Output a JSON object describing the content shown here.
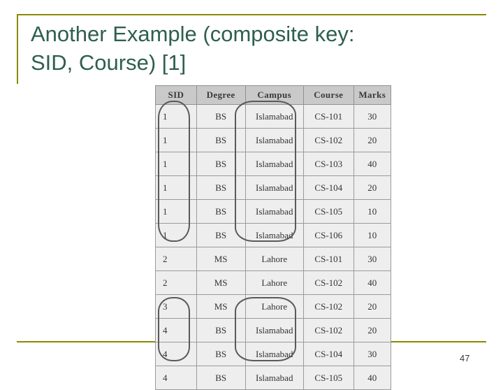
{
  "slide": {
    "title": "Another Example (composite key: SID, Course) [1]",
    "title_line1": "Another Example (composite key:",
    "title_line2": "SID, Course) [1]",
    "number": "47",
    "title_color": "#2e5f4f",
    "accent_color": "#8a8a00"
  },
  "table": {
    "headers": [
      "SID",
      "Degree",
      "Campus",
      "Course",
      "Marks"
    ],
    "rows": [
      [
        "1",
        "BS",
        "Islamabad",
        "CS-101",
        "30"
      ],
      [
        "1",
        "BS",
        "Islamabad",
        "CS-102",
        "20"
      ],
      [
        "1",
        "BS",
        "Islamabad",
        "CS-103",
        "40"
      ],
      [
        "1",
        "BS",
        "Islamabad",
        "CS-104",
        "20"
      ],
      [
        "1",
        "BS",
        "Islamabad",
        "CS-105",
        "10"
      ],
      [
        "1",
        "BS",
        "Islamabad",
        "CS-106",
        "10"
      ],
      [
        "2",
        "MS",
        "Lahore",
        "CS-101",
        "30"
      ],
      [
        "2",
        "MS",
        "Lahore",
        "CS-102",
        "40"
      ],
      [
        "3",
        "MS",
        "Lahore",
        "CS-102",
        "20"
      ],
      [
        "4",
        "BS",
        "Islamabad",
        "CS-102",
        "20"
      ],
      [
        "4",
        "BS",
        "Islamabad",
        "CS-104",
        "30"
      ],
      [
        "4",
        "BS",
        "Islamabad",
        "CS-105",
        "40"
      ]
    ]
  },
  "annotations": {
    "highlight_sid_group_1": "oval around SID value 1 rows",
    "highlight_campus_group_1": "oval around Islamabad rows for SID 1",
    "highlight_sid_group_4": "oval around SID value 4 rows",
    "highlight_campus_group_4": "oval around Islamabad rows for SID 4"
  }
}
